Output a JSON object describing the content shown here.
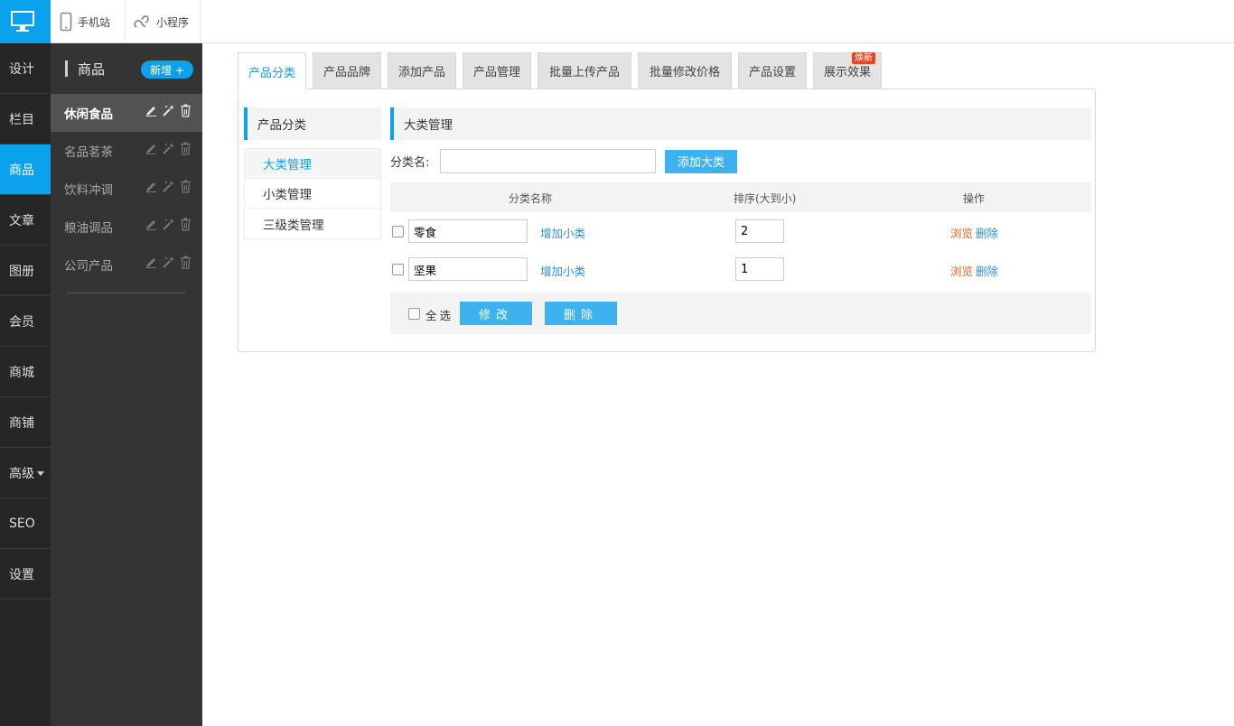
{
  "topbar": {
    "mobile_label": "手机站",
    "mini_label": "小程序"
  },
  "leftnav": {
    "items": [
      {
        "label": "设计"
      },
      {
        "label": "栏目"
      },
      {
        "label": "商品"
      },
      {
        "label": "文章"
      },
      {
        "label": "图册"
      },
      {
        "label": "会员"
      },
      {
        "label": "商城"
      },
      {
        "label": "商铺"
      },
      {
        "label": "高级"
      },
      {
        "label": "SEO"
      },
      {
        "label": "设置"
      }
    ],
    "active": "商品"
  },
  "subnav": {
    "title": "商品",
    "add_label": "新增 +",
    "categories": [
      {
        "label": "休闲食品"
      },
      {
        "label": "名品茗茶"
      },
      {
        "label": "饮料冲调"
      },
      {
        "label": "粮油调品"
      },
      {
        "label": "公司产品"
      }
    ]
  },
  "tabs": [
    {
      "label": "产品分类"
    },
    {
      "label": "产品品牌"
    },
    {
      "label": "添加产品"
    },
    {
      "label": "产品管理"
    },
    {
      "label": "批量上传产品"
    },
    {
      "label": "批量修改价格"
    },
    {
      "label": "产品设置"
    },
    {
      "label": "展示效果",
      "badge": "焕新"
    }
  ],
  "side_menu": {
    "title": "产品分类",
    "items": [
      {
        "label": "大类管理"
      },
      {
        "label": "小类管理"
      },
      {
        "label": "三级类管理"
      }
    ]
  },
  "content": {
    "section_title": "大类管理",
    "name_label": "分类名:",
    "name_value": "",
    "add_button": "添加大类",
    "columns": [
      "分类名称",
      "排序(大到小)",
      "操作"
    ],
    "rows": [
      {
        "name": "零食",
        "add_sub": "增加小类",
        "order": "2",
        "view": "浏览",
        "delete": "删除"
      },
      {
        "name": "坚果",
        "add_sub": "增加小类",
        "order": "1",
        "view": "浏览",
        "delete": "删除"
      }
    ],
    "select_all": "全选",
    "modify_button": "修改",
    "delete_button": "删除"
  },
  "colors": {
    "accent": "#0aa1ed",
    "nav_bg": "#262626",
    "subnav_bg": "#343434",
    "badge": "#e8451e",
    "link": "#2a8fd6",
    "view_link": "#e0641c"
  }
}
